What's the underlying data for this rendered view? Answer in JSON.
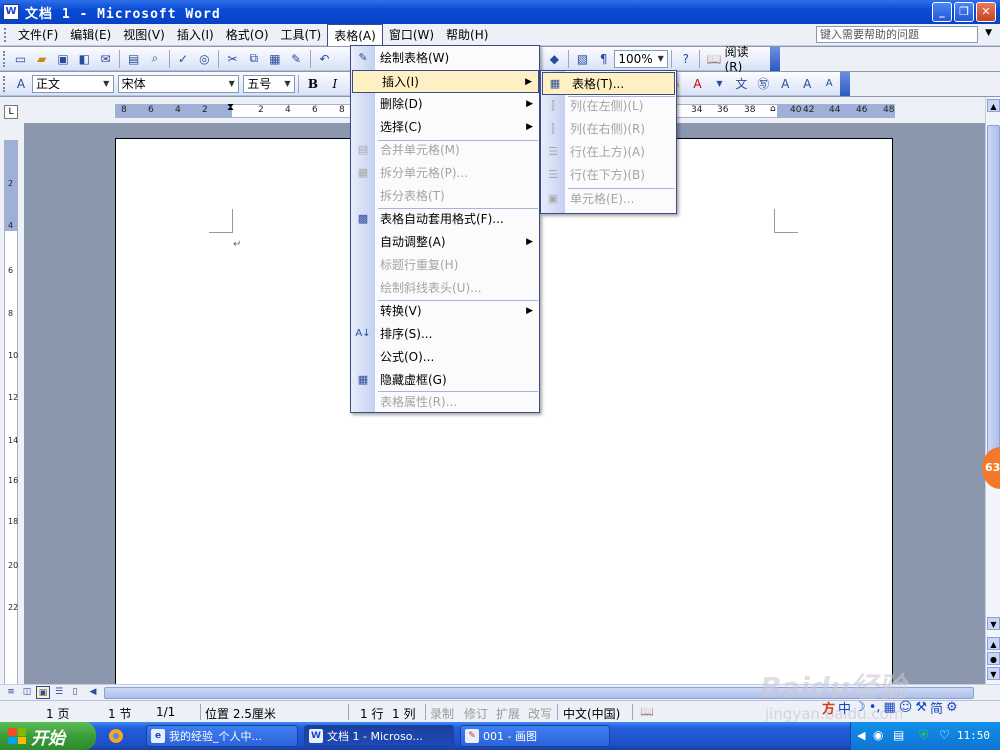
{
  "window": {
    "title": "文档 1 - Microsoft Word"
  },
  "menubar": {
    "items": [
      "文件(F)",
      "编辑(E)",
      "视图(V)",
      "插入(I)",
      "格式(O)",
      "工具(T)",
      "表格(A)",
      "窗口(W)",
      "帮助(H)"
    ],
    "help_placeholder": "键入需要帮助的问题"
  },
  "toolbar": {
    "zoom": "100%",
    "read_label": "阅读(R)"
  },
  "format": {
    "style": "正文",
    "font": "宋体",
    "size": "五号",
    "bold": "B",
    "italic": "I"
  },
  "ruler": {
    "left_nums": [
      "8",
      "6",
      "4",
      "2",
      "2",
      "4",
      "6",
      "8"
    ],
    "right_nums": [
      "34",
      "36",
      "38",
      "40",
      "42",
      "44",
      "46",
      "48"
    ],
    "vnums": [
      "2",
      "4",
      "6",
      "8",
      "10",
      "12",
      "14",
      "16",
      "18",
      "20",
      "22"
    ]
  },
  "table_menu": {
    "items": [
      {
        "label": "绘制表格(W)",
        "disabled": false,
        "icon": "pencil-icon"
      },
      {
        "label": "插入(I)",
        "disabled": false,
        "submenu": true
      },
      {
        "label": "删除(D)",
        "disabled": false,
        "submenu": true
      },
      {
        "label": "选择(C)",
        "disabled": false,
        "submenu": true
      },
      {
        "label": "合并单元格(M)",
        "disabled": true
      },
      {
        "label": "拆分单元格(P)...",
        "disabled": true
      },
      {
        "label": "拆分表格(T)",
        "disabled": true
      },
      {
        "label": "表格自动套用格式(F)...",
        "disabled": false
      },
      {
        "label": "自动调整(A)",
        "disabled": false,
        "submenu": true
      },
      {
        "label": "标题行重复(H)",
        "disabled": true
      },
      {
        "label": "绘制斜线表头(U)...",
        "disabled": true
      },
      {
        "label": "转换(V)",
        "disabled": false,
        "submenu": true
      },
      {
        "label": "排序(S)...",
        "disabled": false
      },
      {
        "label": "公式(O)...",
        "disabled": false
      },
      {
        "label": "隐藏虚框(G)",
        "disabled": false
      },
      {
        "label": "表格属性(R)...",
        "disabled": true
      }
    ]
  },
  "insert_submenu": {
    "items": [
      {
        "label": "表格(T)...",
        "disabled": false
      },
      {
        "label": "列(在左侧)(L)",
        "disabled": true
      },
      {
        "label": "列(在右侧)(R)",
        "disabled": true
      },
      {
        "label": "行(在上方)(A)",
        "disabled": true
      },
      {
        "label": "行(在下方)(B)",
        "disabled": true
      },
      {
        "label": "单元格(E)...",
        "disabled": true
      }
    ]
  },
  "status": {
    "page": "1 页",
    "section": "1 节",
    "pages": "1/1",
    "position": "位置 2.5厘米",
    "line": "1 行",
    "col": "1 列",
    "rec": "录制",
    "trk": "修订",
    "ext": "扩展",
    "ovr": "改写",
    "lang": "中文(中国)"
  },
  "taskbar": {
    "start": "开始",
    "tasks": [
      "我的经验_个人中...",
      "文档 1 - Microso...",
      "001 - 画图"
    ],
    "clock": "11:50"
  },
  "ime": {
    "mode": "中",
    "simplified": "简"
  },
  "badge": "63",
  "watermark": {
    "main": "Baidu经验",
    "sub": "jingyan.baidu.com"
  }
}
